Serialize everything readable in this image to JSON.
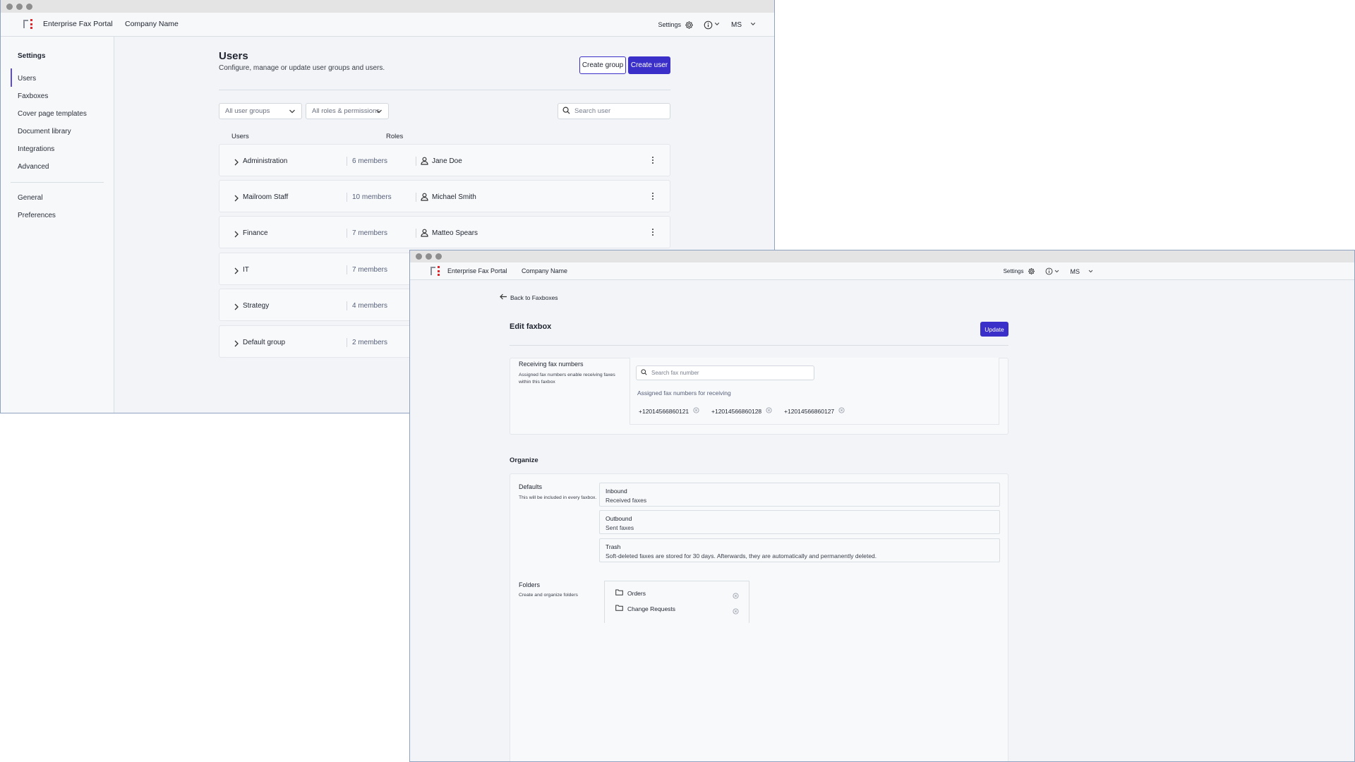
{
  "window1": {
    "app_name": "Enterprise Fax Portal",
    "company": "Company Name",
    "settings_label": "Settings",
    "avatar_initials": "MS",
    "sidebar": {
      "heading": "Settings",
      "items": [
        "Users",
        "Faxboxes",
        "Cover page templates",
        "Document library",
        "Integrations",
        "Advanced"
      ],
      "items2": [
        "General",
        "Preferences"
      ]
    },
    "page": {
      "title": "Users",
      "subtitle": "Configure, manage or update user groups and users.",
      "create_group": "Create group",
      "create_user": "Create user",
      "filter_groups": "All user groups",
      "filter_roles": "All roles & permissions",
      "search_placeholder": "Search user",
      "col_users": "Users",
      "col_roles": "Roles"
    },
    "groups": [
      {
        "name": "Administration",
        "members": "6 members",
        "owner": "Jane Doe"
      },
      {
        "name": "Mailroom Staff",
        "members": "10 members",
        "owner": "Michael Smith"
      },
      {
        "name": "Finance",
        "members": "7 members",
        "owner": "Matteo Spears"
      },
      {
        "name": "IT",
        "members": "7 members",
        "owner": ""
      },
      {
        "name": "Strategy",
        "members": "4 members",
        "owner": ""
      },
      {
        "name": "Default group",
        "members": "2 members",
        "owner": ""
      }
    ]
  },
  "window2": {
    "app_name": "Enterprise Fax Portal",
    "company": "Company Name",
    "settings_label": "Settings",
    "avatar_initials": "MS",
    "back_link": "Back to Faxboxes",
    "title": "Edit faxbox",
    "update_button": "Update",
    "receiving": {
      "heading": "Receiving fax numbers",
      "desc_line1": "Assigned fax numbers enable receiving faxes",
      "desc_line2": "within this faxbox",
      "search_placeholder": "Search fax number",
      "assigned_label": "Assigned fax numbers for receiving",
      "numbers": [
        "+12014566860121",
        "+12014566860128",
        "+12014566860127"
      ]
    },
    "organize": {
      "heading": "Organize",
      "defaults_heading": "Defaults",
      "defaults_desc": "This will be included in every faxbox.",
      "defaults": [
        {
          "title": "Inbound",
          "sub": "Received faxes"
        },
        {
          "title": "Outbound",
          "sub": "Sent faxes"
        },
        {
          "title": "Trash",
          "sub": "Soft-deleted faxes are stored for 30 days. Afterwards, they are automatically and permanently deleted."
        }
      ],
      "folders_heading": "Folders",
      "folders_desc": "Create and organize folders",
      "folders": [
        "Orders",
        "Change Requests"
      ]
    }
  },
  "colors": {
    "primary": "#3b2fc9",
    "logo_red": "#e1252a",
    "background": "#f3f4f7"
  }
}
